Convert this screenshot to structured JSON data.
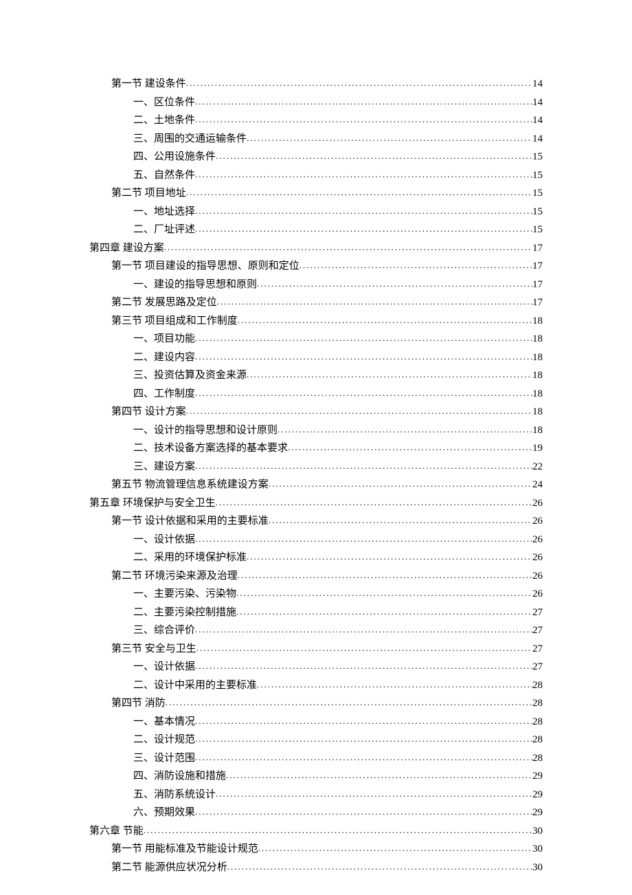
{
  "toc": [
    {
      "label": "第一节  建设条件",
      "page": "14",
      "level": 1
    },
    {
      "label": "一、区位条件",
      "page": "14",
      "level": 2
    },
    {
      "label": "二、土地条件",
      "page": "14",
      "level": 2
    },
    {
      "label": "三、周围的交通运输条件",
      "page": "14",
      "level": 2
    },
    {
      "label": "四、公用设施条件",
      "page": "15",
      "level": 2
    },
    {
      "label": "五、自然条件",
      "page": "15",
      "level": 2
    },
    {
      "label": "第二节  项目地址",
      "page": "15",
      "level": 1
    },
    {
      "label": "一、地址选择",
      "page": "15",
      "level": 2
    },
    {
      "label": "二、厂址评述",
      "page": "15",
      "level": 2
    },
    {
      "label": "第四章  建设方案",
      "page": "17",
      "level": 0
    },
    {
      "label": "第一节  项目建设的指导思想、原则和定位",
      "page": "17",
      "level": 1
    },
    {
      "label": "一、建设的指导思想和原则",
      "page": "17",
      "level": 2
    },
    {
      "label": "第二节  发展思路及定位",
      "page": "17",
      "level": 1
    },
    {
      "label": "第三节  项目组成和工作制度",
      "page": "18",
      "level": 1
    },
    {
      "label": "一、项目功能",
      "page": "18",
      "level": 2
    },
    {
      "label": "二、建设内容",
      "page": "18",
      "level": 2
    },
    {
      "label": "三、投资估算及资金来源",
      "page": "18",
      "level": 2
    },
    {
      "label": "四、工作制度",
      "page": "18",
      "level": 2
    },
    {
      "label": "第四节  设计方案",
      "page": "18",
      "level": 1
    },
    {
      "label": "一、设计的指导思想和设计原则",
      "page": "18",
      "level": 2
    },
    {
      "label": "二、技术设备方案选择的基本要求",
      "page": "19",
      "level": 2
    },
    {
      "label": "三、建设方案",
      "page": "22",
      "level": 2
    },
    {
      "label": "第五节  物流管理信息系统建设方案",
      "page": "24",
      "level": 1
    },
    {
      "label": "第五章  环境保护与安全卫生",
      "page": "26",
      "level": 0
    },
    {
      "label": "第一节  设计依据和采用的主要标准",
      "page": "26",
      "level": 1
    },
    {
      "label": "一、设计依据",
      "page": "26",
      "level": 2
    },
    {
      "label": "二、采用的环境保护标准",
      "page": "26",
      "level": 2
    },
    {
      "label": "第二节  环境污染来源及治理",
      "page": "26",
      "level": 1
    },
    {
      "label": "一、主要污染、污染物",
      "page": "26",
      "level": 2
    },
    {
      "label": "二、主要污染控制措施",
      "page": "27",
      "level": 2
    },
    {
      "label": "三、综合评价",
      "page": "27",
      "level": 2
    },
    {
      "label": "第三节  安全与卫生",
      "page": "27",
      "level": 1
    },
    {
      "label": "一、设计依据",
      "page": "27",
      "level": 2
    },
    {
      "label": "二、设计中采用的主要标准",
      "page": "28",
      "level": 2
    },
    {
      "label": "第四节  消防",
      "page": "28",
      "level": 1
    },
    {
      "label": "一、基本情况",
      "page": "28",
      "level": 2
    },
    {
      "label": "二、设计规范",
      "page": "28",
      "level": 2
    },
    {
      "label": "三、设计范围",
      "page": "28",
      "level": 2
    },
    {
      "label": "四、消防设施和措施",
      "page": "29",
      "level": 2
    },
    {
      "label": "五、消防系统设计",
      "page": "29",
      "level": 2
    },
    {
      "label": "六、预期效果",
      "page": "29",
      "level": 2
    },
    {
      "label": "第六章  节能",
      "page": "30",
      "level": 0
    },
    {
      "label": "第一节  用能标准及节能设计规范",
      "page": "30",
      "level": 1
    },
    {
      "label": "第二节  能源供应状况分析",
      "page": "30",
      "level": 1
    }
  ]
}
